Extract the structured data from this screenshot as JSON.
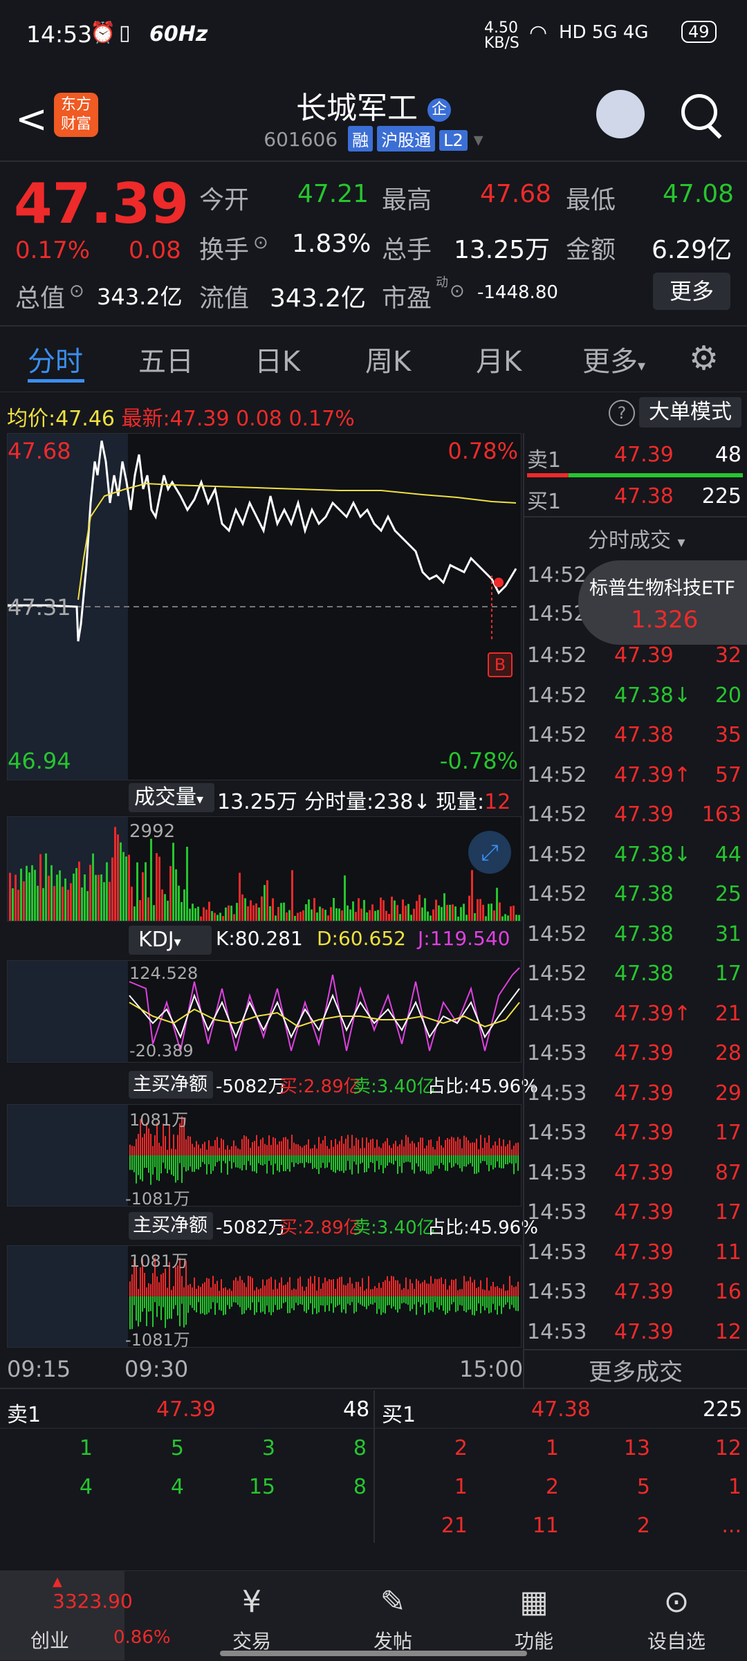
{
  "status_bar": {
    "time": "14:53",
    "refresh": "60Hz",
    "net_speed": "4.50 KB/S",
    "signal": "HD 5G 4G",
    "battery": "49"
  },
  "header": {
    "back": "<",
    "logo": "东方财富",
    "title": "长城军工",
    "title_badge": "企",
    "code": "601606",
    "tags": [
      "融",
      "沪股通",
      "L2"
    ]
  },
  "quote": {
    "price": "47.39",
    "change_pct": "0.17%",
    "change": "0.08",
    "fields": [
      {
        "label": "今开",
        "value": "47.21",
        "color": "green"
      },
      {
        "label": "最高",
        "value": "47.68",
        "color": "red"
      },
      {
        "label": "最低",
        "value": "47.08",
        "color": "green"
      },
      {
        "label": "换手",
        "value": "1.83%",
        "color": "white"
      },
      {
        "label": "总手",
        "value": "13.25万",
        "color": "white"
      },
      {
        "label": "金额",
        "value": "6.29亿",
        "color": "white"
      },
      {
        "label": "总值",
        "value": "343.2亿",
        "color": "white"
      },
      {
        "label": "流值",
        "value": "343.2亿",
        "color": "white"
      },
      {
        "label": "市盈",
        "value": "-1448.80",
        "color": "white"
      }
    ],
    "more_button": "更多",
    "pe_sup": "动"
  },
  "tabs": [
    "分时",
    "五日",
    "日K",
    "周K",
    "月K",
    "更多"
  ],
  "info_line": {
    "avg_label": "均价:",
    "avg": "47.46",
    "latest_label": "最新:",
    "latest": "47.39",
    "chg": "0.08",
    "pct": "0.17%",
    "mode_button": "大单模式"
  },
  "chart": {
    "top_price": "47.68",
    "top_pct": "0.78%",
    "mid_price": "47.31",
    "bottom_price": "46.94",
    "bottom_pct": "-0.78%",
    "b_marker": "B",
    "time_start": "09:15",
    "time_mid": "09:30",
    "time_end": "15:00"
  },
  "volume": {
    "label": "成交量",
    "total": "13.25万",
    "period_label": "分时量:",
    "period": "238",
    "current_label": "现量:",
    "current": "12",
    "max": "2992"
  },
  "kdj": {
    "label": "KDJ",
    "k": "K:80.281",
    "d": "D:60.652",
    "j": "J:119.540",
    "max": "124.528",
    "min": "-20.389"
  },
  "net_buy": {
    "label": "主买净额",
    "value": "-5082万",
    "buy": "买:2.89亿",
    "sell": "卖:3.40亿",
    "ratio": "占比:45.96%",
    "max": "1081万",
    "min": "-1081万"
  },
  "order_book_top": {
    "sell": {
      "label": "卖1",
      "price": "47.39",
      "qty": "48"
    },
    "buy": {
      "label": "买1",
      "price": "47.38",
      "qty": "225"
    },
    "title": "分时成交"
  },
  "trades": [
    {
      "time": "14:52",
      "price": "47.39",
      "arrow": "",
      "qty": "32",
      "color": "red"
    },
    {
      "time": "14:52",
      "price": "47.38",
      "arrow": "↓",
      "qty": "20",
      "color": "green"
    },
    {
      "time": "14:52",
      "price": "47.38",
      "arrow": "",
      "qty": "35",
      "color": "red"
    },
    {
      "time": "14:52",
      "price": "47.39",
      "arrow": "↑",
      "qty": "57",
      "color": "red"
    },
    {
      "time": "14:52",
      "price": "47.39",
      "arrow": "",
      "qty": "163",
      "color": "red"
    },
    {
      "time": "14:52",
      "price": "47.38",
      "arrow": "↓",
      "qty": "44",
      "color": "green"
    },
    {
      "time": "14:52",
      "price": "47.38",
      "arrow": "",
      "qty": "25",
      "color": "green"
    },
    {
      "time": "14:52",
      "price": "47.38",
      "arrow": "",
      "qty": "31",
      "color": "green"
    },
    {
      "time": "14:52",
      "price": "47.38",
      "arrow": "",
      "qty": "17",
      "color": "green"
    },
    {
      "time": "14:53",
      "price": "47.39",
      "arrow": "↑",
      "qty": "21",
      "color": "red"
    },
    {
      "time": "14:53",
      "price": "47.39",
      "arrow": "",
      "qty": "28",
      "color": "red"
    },
    {
      "time": "14:53",
      "price": "47.39",
      "arrow": "",
      "qty": "29",
      "color": "red"
    },
    {
      "time": "14:53",
      "price": "47.39",
      "arrow": "",
      "qty": "17",
      "color": "red"
    },
    {
      "time": "14:53",
      "price": "47.39",
      "arrow": "",
      "qty": "87",
      "color": "red"
    },
    {
      "time": "14:53",
      "price": "47.39",
      "arrow": "",
      "qty": "17",
      "color": "red"
    },
    {
      "time": "14:53",
      "price": "47.39",
      "arrow": "",
      "qty": "11",
      "color": "red"
    },
    {
      "time": "14:53",
      "price": "47.39",
      "arrow": "",
      "qty": "16",
      "color": "red"
    },
    {
      "time": "14:53",
      "price": "47.39",
      "arrow": "",
      "qty": "12",
      "color": "red"
    }
  ],
  "trades_top_times": [
    "14:52",
    "14:52"
  ],
  "popup": {
    "name": "标普生物科技ETF",
    "price": "1.326"
  },
  "more_trades": "更多成交",
  "queue": {
    "sell_label": "卖1",
    "sell_price": "47.39",
    "sell_qty": "48",
    "buy_label": "买1",
    "buy_price": "47.38",
    "buy_qty": "225",
    "sell_rows": [
      [
        "1",
        "5",
        "3",
        "8"
      ],
      [
        "4",
        "4",
        "15",
        "8"
      ]
    ],
    "buy_rows": [
      [
        "2",
        "1",
        "13",
        "12"
      ],
      [
        "1",
        "2",
        "5",
        "1"
      ],
      [
        "21",
        "11",
        "2",
        "..."
      ]
    ]
  },
  "nav": {
    "index": {
      "value": "3323.90",
      "name": "创业",
      "pct": "0.86%"
    },
    "items": [
      "交易",
      "发帖",
      "功能",
      "设自选"
    ]
  },
  "colors": {
    "red": "#ee2a2a",
    "green": "#27c52f",
    "bg": "#15171c",
    "accent": "#3b8ef0"
  }
}
